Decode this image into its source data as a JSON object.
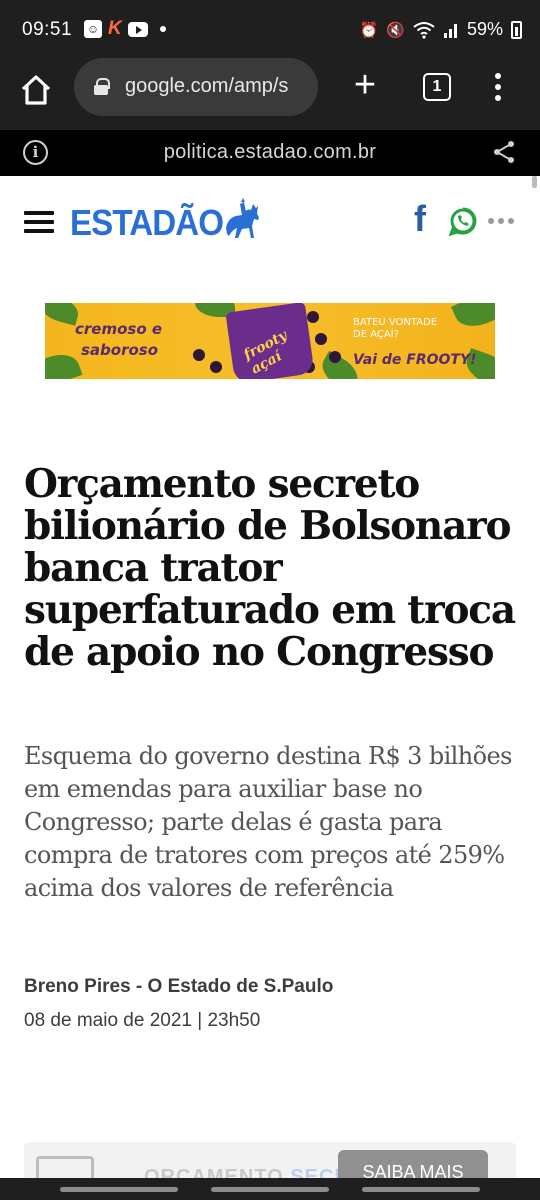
{
  "status_bar": {
    "time": "09:51",
    "battery": "59%",
    "icons": [
      "smiley-notification-icon",
      "k-app-icon",
      "youtube-icon",
      "dot-icon",
      "alarm-icon",
      "mute-icon",
      "wifi-icon",
      "signal-icon",
      "battery-icon"
    ]
  },
  "browser": {
    "url": "google.com/amp/s",
    "tab_count": "1"
  },
  "amp_header": {
    "domain": "politica.estadao.com.br"
  },
  "site": {
    "logo": "ESTADÃO",
    "facebook_glyph": "f"
  },
  "ad": {
    "left_text_1": "cremoso e",
    "left_text_2": "saboroso",
    "cup_label": "frooty açaí",
    "right_text_1": "BATEU VONTADE",
    "right_text_2": "DE AÇAÍ?",
    "right_text_3": "Vai de FROOTY!"
  },
  "article": {
    "headline": "Orçamento secreto bilionário de Bolsonaro banca trator superfaturado em troca de apoio no Congresso",
    "subtitle": "Esquema do governo destina R$ 3 bilhões em emendas para auxiliar base no Congresso; parte delas é gasta para compra de tratores com preços até 259% acima dos valores de referência",
    "byline": "Breno Pires - O Estado de S.Paulo",
    "date": "08 de maio de 2021 | 23h50"
  },
  "promo": {
    "title_part1": "ORÇAMENTO ",
    "title_part2": "SECRETO",
    "button": "SAIBA MAIS"
  },
  "colors": {
    "chrome_dark": "#1f1f1f",
    "estadao_blue": "#2a6fd6",
    "whatsapp_green": "#25a244",
    "facebook_blue": "#2a5ca8"
  }
}
